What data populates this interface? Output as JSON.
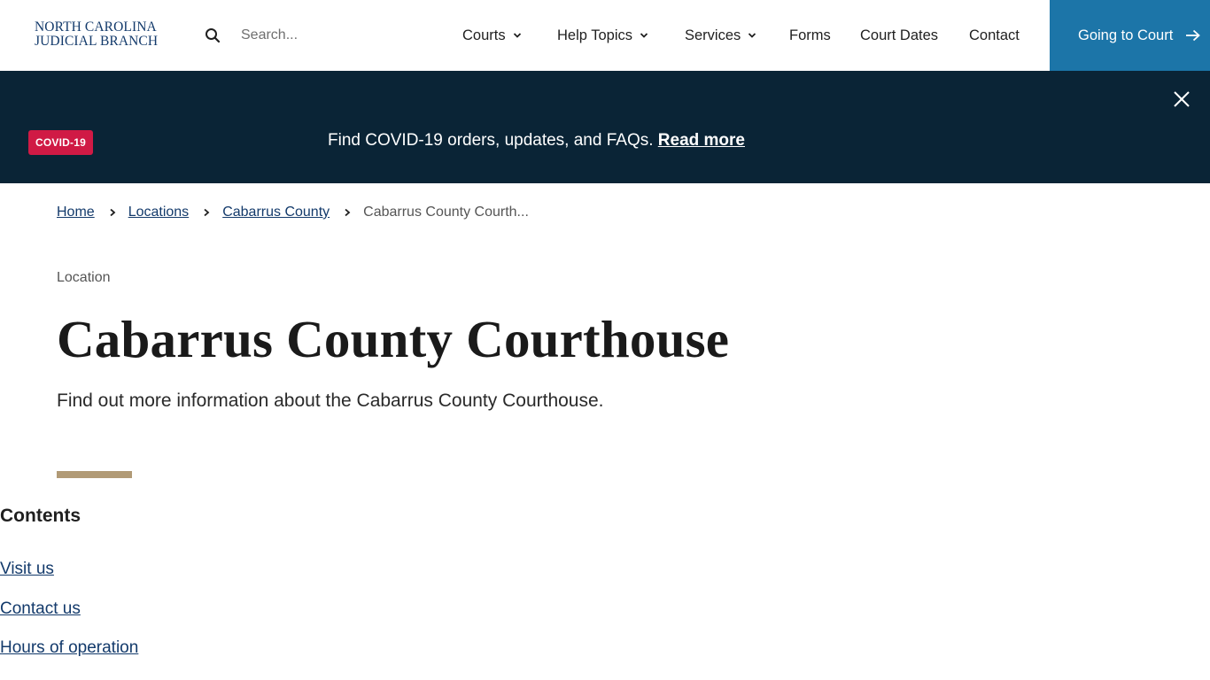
{
  "header": {
    "logo_line1": "NORTH CAROLINA",
    "logo_line2": "JUDICIAL BRANCH",
    "search_placeholder": "Search...",
    "nav": [
      {
        "label": "Courts",
        "has_dropdown": true
      },
      {
        "label": "Help Topics",
        "has_dropdown": true
      },
      {
        "label": "Services",
        "has_dropdown": true
      },
      {
        "label": "Forms",
        "has_dropdown": false
      },
      {
        "label": "Court Dates",
        "has_dropdown": false
      },
      {
        "label": "Contact",
        "has_dropdown": false
      }
    ],
    "cta_label": "Going to Court"
  },
  "banner": {
    "badge": "COVID-19",
    "message": "Find COVID-19 orders, updates, and FAQs.",
    "link": "Read more"
  },
  "breadcrumb": {
    "items": [
      "Home",
      "Locations",
      "Cabarrus County"
    ],
    "current": "Cabarrus County Courth..."
  },
  "main": {
    "eyebrow": "Location",
    "title": "Cabarrus County Courthouse",
    "lede": "Find out more information about the Cabarrus County Courthouse."
  },
  "contents": {
    "heading": "Contents",
    "links": [
      "Visit us",
      "Contact us",
      "Hours of operation"
    ]
  },
  "colors": {
    "brand_navy": "#133a6b",
    "cta_blue": "#1c75a8",
    "banner_bg": "#0a2436",
    "badge_red": "#d01a45",
    "accent_tan": "#b19a76"
  }
}
